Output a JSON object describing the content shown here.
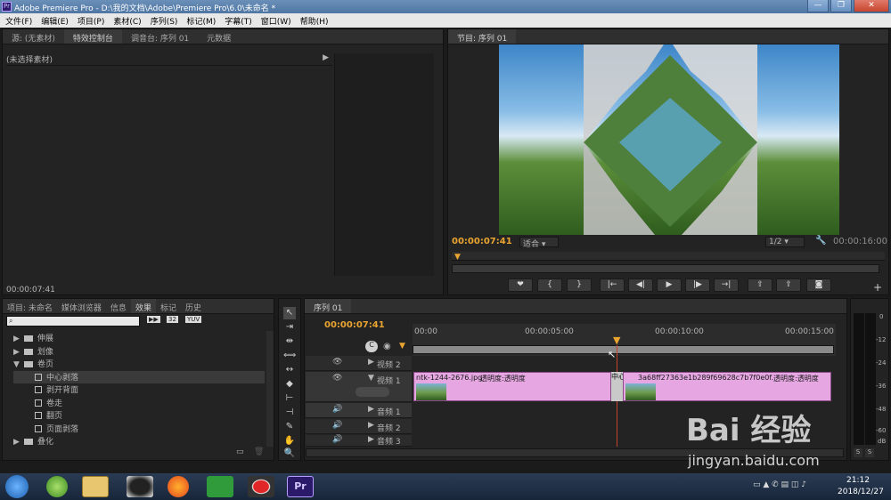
{
  "window": {
    "title": "Adobe Premiere Pro - D:\\我的文档\\Adobe\\Premiere Pro\\6.0\\未命名 *",
    "app_icon": "Pr",
    "buttons": [
      "—",
      "❐",
      "✕"
    ]
  },
  "menu": [
    "文件(F)",
    "编辑(E)",
    "项目(P)",
    "素材(C)",
    "序列(S)",
    "标记(M)",
    "字幕(T)",
    "窗口(W)",
    "帮助(H)"
  ],
  "source_panel": {
    "tabs": [
      "源: (无素材)",
      "特效控制台",
      "调音台: 序列 01",
      "元数据"
    ],
    "no_clip": "(未选择素材)",
    "timecode": "00:00:07:41"
  },
  "program_monitor": {
    "tab": "节目: 序列 01",
    "timecode": "00:00:07:41",
    "fit": "适合",
    "resolution": "1/2",
    "duration": "00:00:16:00",
    "controls": [
      "❤",
      "{",
      "}",
      "|←",
      "◀|",
      "▶",
      "|▶",
      "→|"
    ],
    "progress": 0.48
  },
  "project_panel": {
    "tabs": [
      "项目: 未命名",
      "媒体浏览器",
      "信息",
      "效果",
      "标记",
      "历史"
    ],
    "badges": [
      "▶▶",
      "32",
      "YUV"
    ],
    "tree": [
      {
        "label": "伸展",
        "type": "folder",
        "open": false,
        "level": 1
      },
      {
        "label": "划像",
        "type": "folder",
        "open": false,
        "level": 1
      },
      {
        "label": "卷页",
        "type": "folder",
        "open": true,
        "level": 1
      },
      {
        "label": "中心剥落",
        "type": "effect",
        "level": 2,
        "selected": true
      },
      {
        "label": "剥开背面",
        "type": "effect",
        "level": 2
      },
      {
        "label": "卷走",
        "type": "effect",
        "level": 2
      },
      {
        "label": "翻页",
        "type": "effect",
        "level": 2
      },
      {
        "label": "页面剥落",
        "type": "effect",
        "level": 2
      },
      {
        "label": "叠化",
        "type": "folder",
        "open": false,
        "level": 1
      }
    ]
  },
  "timeline": {
    "tab": "序列 01",
    "timecode": "00:00:07:41",
    "ruler": [
      "00:00",
      "00:00:05:00",
      "00:00:10:00",
      "00:00:15:00"
    ],
    "playhead_fraction": 0.48,
    "tracks": [
      {
        "name": "视频 2",
        "kind": "video"
      },
      {
        "name": "视频 1",
        "kind": "video"
      },
      {
        "name": "音频 1",
        "kind": "audio"
      },
      {
        "name": "音频 2",
        "kind": "audio"
      },
      {
        "name": "音频 3",
        "kind": "audio"
      }
    ],
    "clips": [
      {
        "name": "ntk-1244-2676.jpg",
        "fx": "透明度:透明度"
      },
      {
        "name": "3a68ff27363e1b289f69628c7b7f0e0f.jpg",
        "fx": "透明度:透明度"
      }
    ],
    "transition": "中心剥"
  },
  "vu_meter": {
    "labels": [
      "0",
      "-12",
      "-24",
      "-36",
      "-48",
      "-60",
      "dB"
    ],
    "solo": [
      "S",
      "S"
    ]
  },
  "watermark": {
    "brand": "Bai 经验",
    "url": "jingyan.baidu.com"
  },
  "taskbar": {
    "time": "21:12",
    "date": "2018/12/27",
    "pr": "Pr"
  },
  "colors": {
    "accent": "#e9a530",
    "clip": "#e6a6e2",
    "playhead": "#c1442c"
  }
}
